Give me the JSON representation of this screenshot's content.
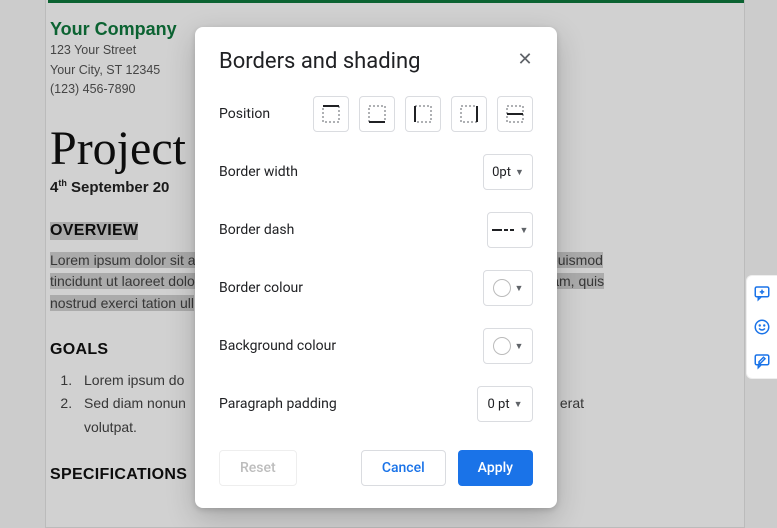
{
  "doc": {
    "company_name": "Your Company",
    "address_line1": "123 Your Street",
    "address_line2": "Your City, ST 12345",
    "phone": "(123) 456-7890",
    "title": "Project",
    "date_day": "4",
    "date_ord": "th",
    "date_rest": " September 20",
    "overview_h": "OVERVIEW",
    "overview_text_pre": "Lorem ipsum dolor sit a",
    "overview_hl1": "h euismod",
    "overview_mid": "tincidunt ut laoreet dolo",
    "overview_hl2": "eniam, quis",
    "overview_tail": "nostrud exerci tation ull",
    "goals_h": "GOALS",
    "goal1": "Lorem ipsum do",
    "goal2a": "Sed diam nonun",
    "goal2b": "uam erat",
    "goal2c": "volutpat.",
    "specs_h": "SPECIFICATIONS"
  },
  "modal": {
    "title": "Borders and shading",
    "labels": {
      "position": "Position",
      "border_width": "Border width",
      "border_dash": "Border dash",
      "border_colour": "Border colour",
      "background_colour": "Background colour",
      "paragraph_padding": "Paragraph padding"
    },
    "values": {
      "border_width": "0pt",
      "paragraph_padding": "0 pt"
    },
    "buttons": {
      "reset": "Reset",
      "cancel": "Cancel",
      "apply": "Apply"
    }
  }
}
